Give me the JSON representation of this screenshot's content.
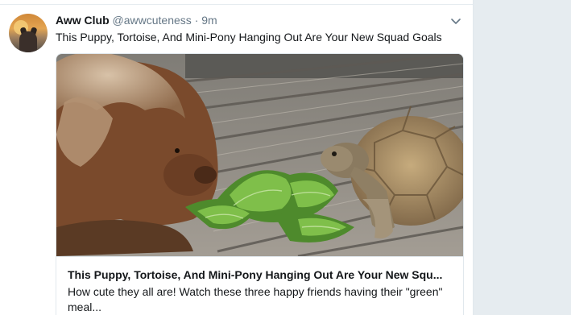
{
  "tweet": {
    "display_name": "Aww Club",
    "handle": "@awwcuteness",
    "separator": "·",
    "time": "9m",
    "text": "This Puppy, Tortoise, And Mini-Pony Hanging Out Are Your New Squad Goals",
    "menu_icon": "chevron-down-icon",
    "avatar_icon": "dog-at-sunset-avatar"
  },
  "card": {
    "title": "This Puppy, Tortoise, And Mini-Pony Hanging Out Are Your New Squ...",
    "description": "How cute they all are! Watch these three happy friends having their \"green\" meal..."
  },
  "colors": {
    "background": "#e6ecf0",
    "text": "#14171a",
    "secondary_text": "#657786",
    "border": "#e1e8ed"
  }
}
